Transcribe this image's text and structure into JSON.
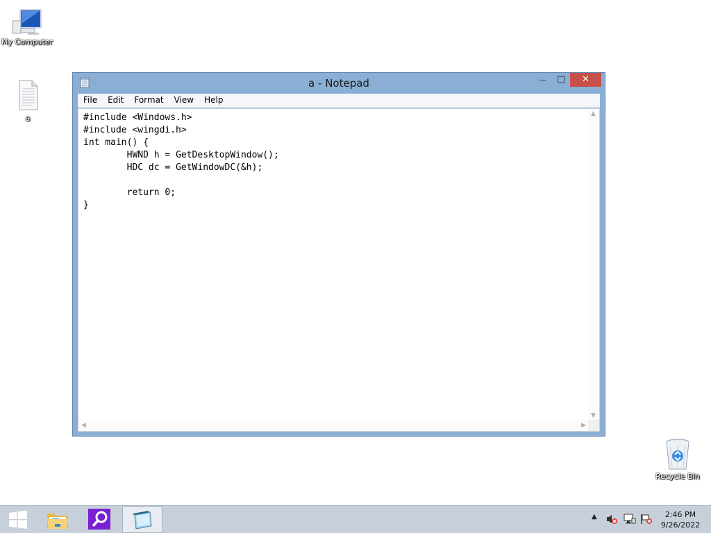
{
  "desktop": {
    "icons": [
      {
        "label": "My Computer",
        "icon": "computer-icon"
      },
      {
        "label": "a",
        "icon": "text-file-icon"
      },
      {
        "label": "Recycle Bin",
        "icon": "recycle-bin-icon"
      }
    ]
  },
  "notepad": {
    "title": "a - Notepad",
    "menu": [
      "File",
      "Edit",
      "Format",
      "View",
      "Help"
    ],
    "close_glyph": "✕",
    "minimize_glyph": "—",
    "maximize_glyph": "□",
    "content": "#include <Windows.h>\n#include <wingdi.h>\nint main() {\n\tHWND h = GetDesktopWindow();\n\tHDC dc = GetWindowDC(&h);\n\n\treturn 0;\n}"
  },
  "taskbar": {
    "buttons": [
      "start-button",
      "file-explorer",
      "search",
      "notepad"
    ],
    "clock": {
      "time": "2:46 PM",
      "date": "9/26/2022"
    }
  },
  "colors": {
    "window_frame": "#8aaed4",
    "close_button": "#c7504a",
    "taskbar": "#c7d0da",
    "search_tile": "#7a1fd1"
  }
}
